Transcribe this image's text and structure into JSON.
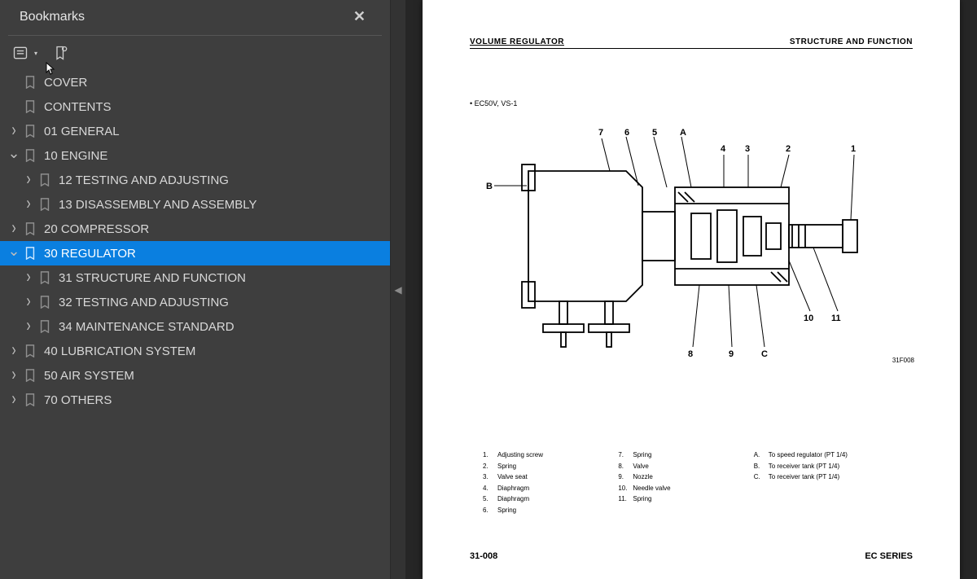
{
  "sidebar": {
    "title": "Bookmarks",
    "tree": [
      {
        "level": 0,
        "chev": "",
        "label": "COVER",
        "selected": false
      },
      {
        "level": 0,
        "chev": "",
        "label": "CONTENTS",
        "selected": false
      },
      {
        "level": 0,
        "chev": "right",
        "label": "01 GENERAL",
        "selected": false
      },
      {
        "level": 0,
        "chev": "down",
        "label": "10 ENGINE",
        "selected": false
      },
      {
        "level": 1,
        "chev": "right",
        "label": "12 TESTING AND ADJUSTING",
        "selected": false
      },
      {
        "level": 1,
        "chev": "right",
        "label": "13 DISASSEMBLY AND ASSEMBLY",
        "selected": false
      },
      {
        "level": 0,
        "chev": "right",
        "label": "20 COMPRESSOR",
        "selected": false
      },
      {
        "level": 0,
        "chev": "down",
        "label": "30 REGULATOR",
        "selected": true
      },
      {
        "level": 1,
        "chev": "right",
        "label": "31 STRUCTURE AND FUNCTION",
        "selected": false
      },
      {
        "level": 1,
        "chev": "right",
        "label": "32 TESTING AND ADJUSTING",
        "selected": false
      },
      {
        "level": 1,
        "chev": "right",
        "label": "34 MAINTENANCE STANDARD",
        "selected": false
      },
      {
        "level": 0,
        "chev": "right",
        "label": "40 LUBRICATION SYSTEM",
        "selected": false
      },
      {
        "level": 0,
        "chev": "right",
        "label": "50 AIR SYSTEM",
        "selected": false
      },
      {
        "level": 0,
        "chev": "right",
        "label": "70 OTHERS",
        "selected": false
      }
    ]
  },
  "page": {
    "header_left": "VOLUME REGULATOR",
    "header_right": "STRUCTURE AND FUNCTION",
    "model": "EC50V, VS-1",
    "diagram_code": "31F008",
    "callouts_col1": [
      {
        "k": "1.",
        "v": "Adjusting screw"
      },
      {
        "k": "2.",
        "v": "Spring"
      },
      {
        "k": "3.",
        "v": "Valve seat"
      },
      {
        "k": "4.",
        "v": "Diaphragm"
      },
      {
        "k": "5.",
        "v": "Diaphragm"
      },
      {
        "k": "6.",
        "v": "Spring"
      }
    ],
    "callouts_col2": [
      {
        "k": "7.",
        "v": "Spring"
      },
      {
        "k": "8.",
        "v": "Valve"
      },
      {
        "k": "9.",
        "v": "Nozzle"
      },
      {
        "k": "10.",
        "v": "Needle valve"
      },
      {
        "k": "11.",
        "v": "Spring"
      }
    ],
    "callouts_col3": [
      {
        "k": "A.",
        "v": "To speed regulator (PT 1/4)"
      },
      {
        "k": "B.",
        "v": "To receiver tank (PT 1/4)"
      },
      {
        "k": "C.",
        "v": "To receiver tank (PT 1/4)"
      }
    ],
    "footer_left": "31-008",
    "footer_right": "EC SERIES"
  }
}
